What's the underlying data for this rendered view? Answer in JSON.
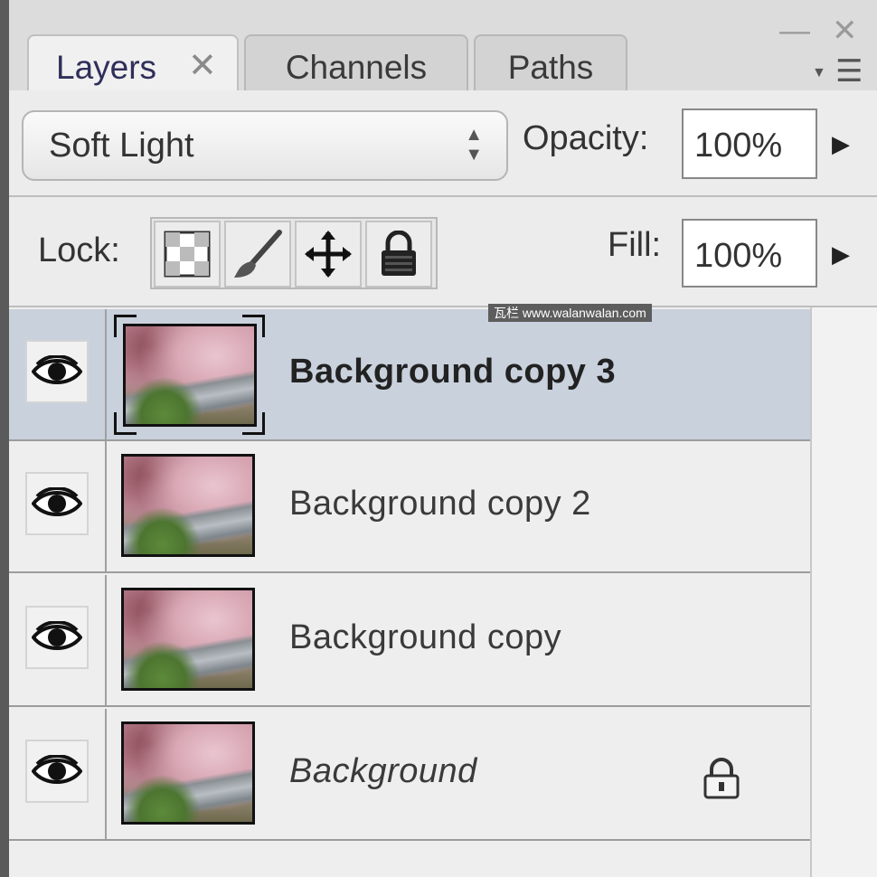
{
  "panel": {
    "tabs": [
      {
        "label": "Layers",
        "active": true
      },
      {
        "label": "Channels",
        "active": false
      },
      {
        "label": "Paths",
        "active": false
      }
    ],
    "tab_close_glyph": "✕",
    "window_buttons": {
      "minimize": "—",
      "close": "✕"
    }
  },
  "toolbar": {
    "blend_mode": "Soft Light",
    "opacity_label": "Opacity:",
    "opacity_value": "100%",
    "lock_label": "Lock:",
    "fill_label": "Fill:",
    "fill_value": "100%",
    "lock_icons": [
      "lock-transparent-pixels-icon",
      "lock-image-pixels-icon",
      "lock-position-icon",
      "lock-all-icon"
    ]
  },
  "layers": [
    {
      "name": "Background copy 3",
      "visible": true,
      "selected": true,
      "italic": false,
      "locked": false
    },
    {
      "name": "Background copy 2",
      "visible": true,
      "selected": false,
      "italic": false,
      "locked": false
    },
    {
      "name": "Background copy",
      "visible": true,
      "selected": false,
      "italic": false,
      "locked": false
    },
    {
      "name": "Background",
      "visible": true,
      "selected": false,
      "italic": true,
      "locked": true
    }
  ],
  "watermark": "瓦栏 www.walanwalan.com",
  "colors": {
    "selected_row": "#c9d1dd",
    "active_tab_text": "#2f2f5a"
  }
}
